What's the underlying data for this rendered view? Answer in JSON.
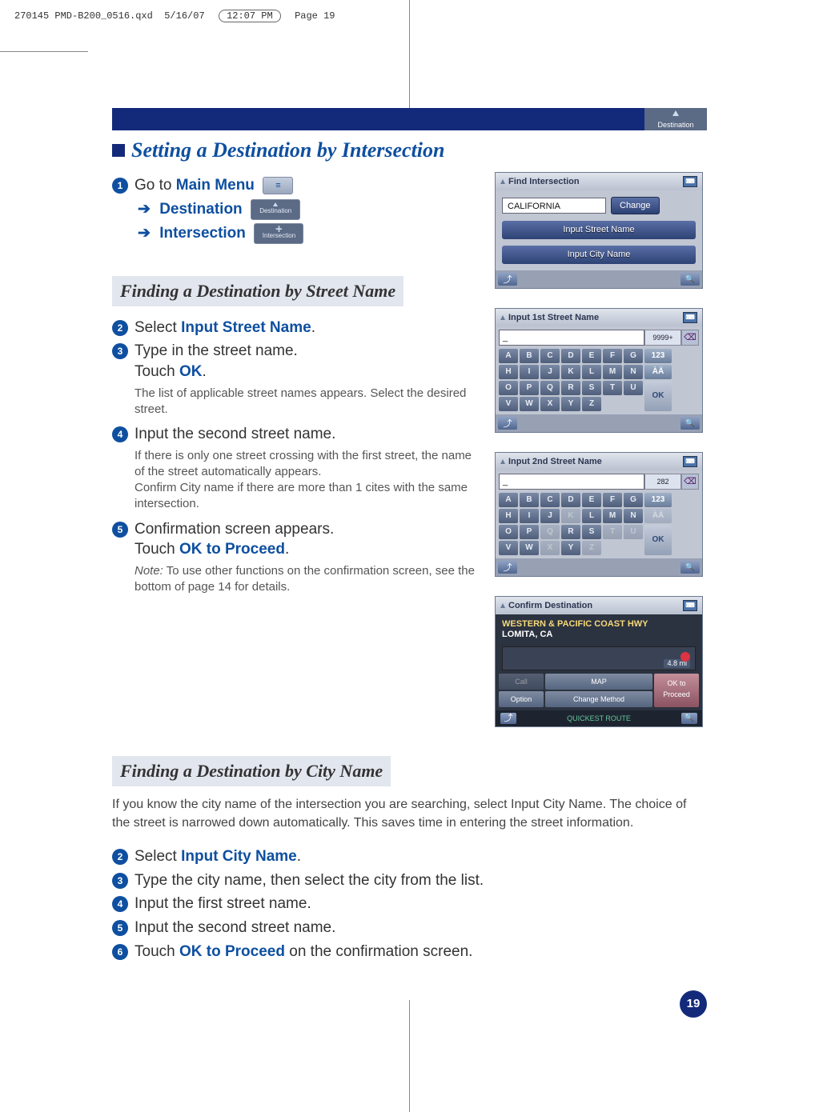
{
  "print_marks": {
    "filename": "270145 PMD-B200_0516.qxd",
    "date": "5/16/07",
    "time": "12:07 PM",
    "page_label": "Page 19"
  },
  "header_badge": "Destination",
  "title": "Setting a Destination by Intersection",
  "nav": {
    "step1_prefix": "Go to ",
    "step1_link": "Main Menu",
    "arrow2": "Destination",
    "arrow3": "Intersection",
    "mini_menu_label": "≡",
    "mini_dest_label": "Destination",
    "mini_inter_label": "Intersection"
  },
  "section_a": "Finding a Destination by Street Name",
  "steps_a": {
    "s2_a": "Select ",
    "s2_b": "Input Street Name",
    "s2_c": ".",
    "s3_a": "Type in the street name.",
    "s3_b": "Touch ",
    "s3_c": "OK",
    "s3_d": ".",
    "s3_sub": "The list of applicable street names appears. Select the desired street.",
    "s4_a": "Input the second street name.",
    "s4_sub": "If there is only one street crossing with the first street, the name of the street automatically appears.\nConfirm City name if there are more than 1 cites with the same intersection.",
    "s5_a": "Confirmation screen appears.",
    "s5_b": "Touch ",
    "s5_c": "OK to Proceed",
    "s5_d": ".",
    "note_label": "Note:",
    "note_body": " To use other functions on the confirmation screen, see the bottom of page 14 for details."
  },
  "section_b": "Finding a Destination by City Name",
  "intro_b": "If you know the city name of the intersection you are searching, select Input City Name. The choice of the street is narrowed down automatically. This saves time in entering the street information.",
  "steps_b": {
    "s2_a": "Select ",
    "s2_b": "Input City Name",
    "s2_c": ".",
    "s3": "Type the city name, then select the city from the list.",
    "s4": "Input the first street name.",
    "s5": "Input the second street name.",
    "s6_a": "Touch ",
    "s6_b": "OK to Proceed",
    "s6_c": " on the confirmation screen."
  },
  "page_number": "19",
  "ss_find": {
    "title": "Find Intersection",
    "field": "CALIFORNIA",
    "change": "Change",
    "btn_street": "Input Street Name",
    "btn_city": "Input City Name"
  },
  "ss_kbd1": {
    "title": "Input 1st Street Name",
    "value": "_",
    "count": "9999+",
    "rows": [
      [
        "A",
        "B",
        "C",
        "D",
        "E",
        "F",
        "G",
        "123"
      ],
      [
        "H",
        "I",
        "J",
        "K",
        "L",
        "M",
        "N",
        "ÀÄ"
      ],
      [
        "O",
        "P",
        "Q",
        "R",
        "S",
        "T",
        "U",
        "OK"
      ],
      [
        "V",
        "W",
        "X",
        "Y",
        "Z",
        "",
        "",
        ""
      ]
    ],
    "disabled": []
  },
  "ss_kbd2": {
    "title": "Input 2nd Street Name",
    "value": "_",
    "count": "282",
    "rows": [
      [
        "A",
        "B",
        "C",
        "D",
        "E",
        "F",
        "G",
        "123"
      ],
      [
        "H",
        "I",
        "J",
        "K",
        "L",
        "M",
        "N",
        "ÀÄ"
      ],
      [
        "O",
        "P",
        "Q",
        "R",
        "S",
        "T",
        "U",
        "OK"
      ],
      [
        "V",
        "W",
        "X",
        "Y",
        "Z",
        "",
        "",
        ""
      ]
    ],
    "disabled": [
      "K",
      "Q",
      "T",
      "U",
      "X",
      "Z",
      "ÀÄ"
    ]
  },
  "ss_confirm": {
    "title": "Confirm Destination",
    "addr1": "WESTERN & PACIFIC COAST HWY",
    "addr2": "LOMITA, CA",
    "distance": "4.8 mi",
    "btns": {
      "call": "Call",
      "map": "MAP",
      "ok": "OK to\nProceed",
      "option": "Option",
      "change": "Change Method"
    },
    "route": "QUICKEST ROUTE"
  }
}
